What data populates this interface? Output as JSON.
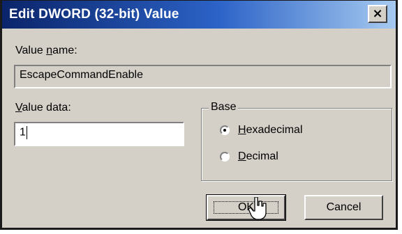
{
  "window": {
    "title": "Edit DWORD (32-bit) Value",
    "close_glyph": "×"
  },
  "value_name": {
    "label_pre": "Value ",
    "label_access": "n",
    "label_post": "ame:",
    "value": "EscapeCommandEnable"
  },
  "value_data": {
    "label_access": "V",
    "label_post": "alue data:",
    "value": "1"
  },
  "base": {
    "title": "Base",
    "options": [
      {
        "access": "H",
        "rest": "exadecimal",
        "selected": true
      },
      {
        "access": "D",
        "rest": "ecimal",
        "selected": false
      }
    ]
  },
  "buttons": {
    "ok": "OK",
    "cancel": "Cancel"
  },
  "colors": {
    "dialog_bg": "#d4d0c8",
    "title_start": "#0a246a",
    "title_end": "#a6caf0"
  }
}
